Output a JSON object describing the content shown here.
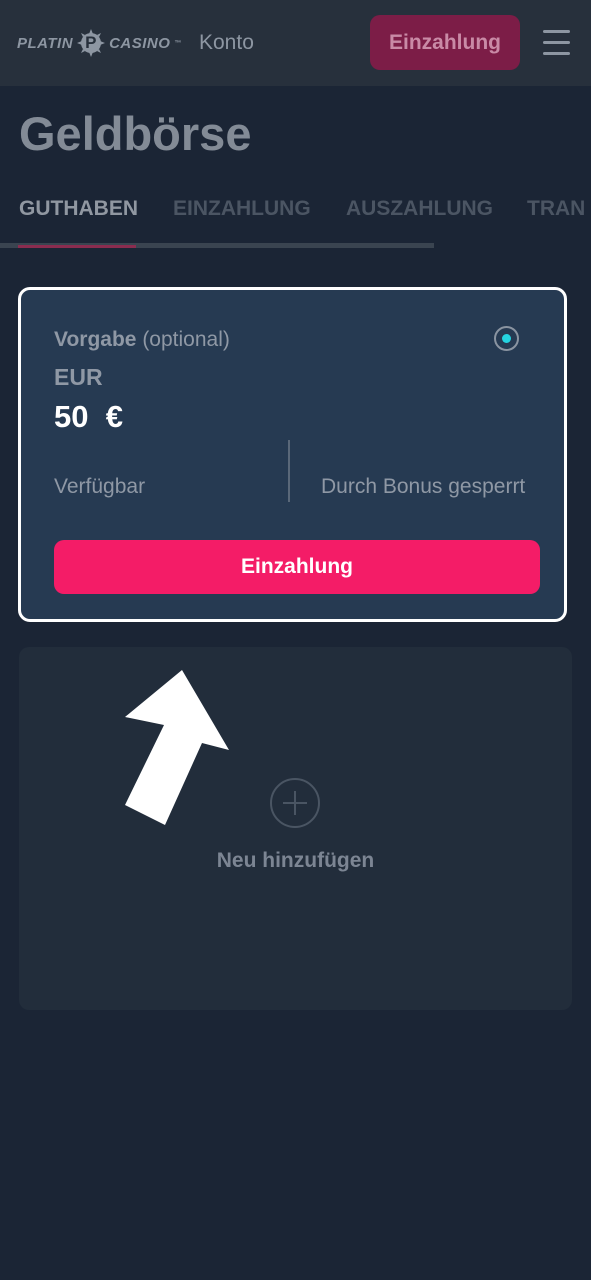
{
  "header": {
    "logo_left": "PLATIN",
    "logo_badge": "P",
    "logo_right": "CASINO",
    "logo_tm": "™",
    "account_link": "Konto",
    "deposit_button": "Einzahlung",
    "menu_icon": "hamburger-menu-icon"
  },
  "page": {
    "title": "Geldbörse"
  },
  "tabs": [
    {
      "label": "GUTHABEN",
      "active": true
    },
    {
      "label": "EINZAHLUNG",
      "active": false
    },
    {
      "label": "AUSZAHLUNG",
      "active": false
    },
    {
      "label": "TRAN",
      "active": false
    }
  ],
  "wallet": {
    "label_bold": "Vorgabe",
    "label_optional": "(optional)",
    "currency": "EUR",
    "amount": "50  €",
    "available_label": "Verfügbar",
    "locked_label": "Durch Bonus gesperrt",
    "deposit_button": "Einzahlung",
    "selected": true
  },
  "add_wallet": {
    "label": "Neu hinzufügen",
    "icon": "plus-circle-icon"
  },
  "colors": {
    "background": "#1b2535",
    "header": "#27303c",
    "card": "#263a52",
    "accent": "#f41c67",
    "radio_dot": "#25d3e0"
  }
}
